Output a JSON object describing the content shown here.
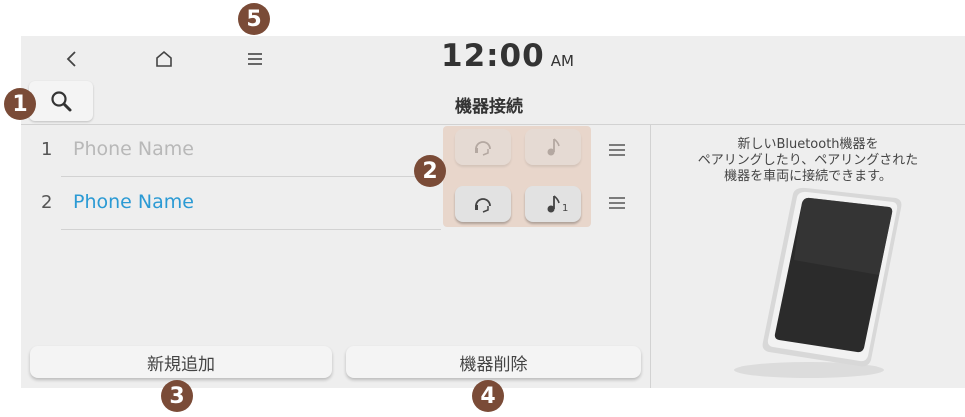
{
  "status_bar": {
    "time": "12:00",
    "ampm": "AM"
  },
  "header": {
    "title": "機器接続"
  },
  "devices": [
    {
      "number": "1",
      "name": "Phone Name",
      "state": "disconnected"
    },
    {
      "number": "2",
      "name": "Phone Name",
      "state": "connected",
      "audio_badge": "1"
    }
  ],
  "buttons": {
    "add_new": "新規追加",
    "delete_device": "機器削除"
  },
  "side_panel": {
    "line1": "新しいBluetooth機器を",
    "line2": "ペアリングしたり、ペアリングされた",
    "line3": "機器を車両に接続できます。"
  },
  "callouts": {
    "c1": "1",
    "c2": "2",
    "c3": "3",
    "c4": "4",
    "c5": "5"
  },
  "colors": {
    "accent": "#2b9ad4",
    "callout": "#7a4b37",
    "highlight": "#e8d6cb"
  }
}
